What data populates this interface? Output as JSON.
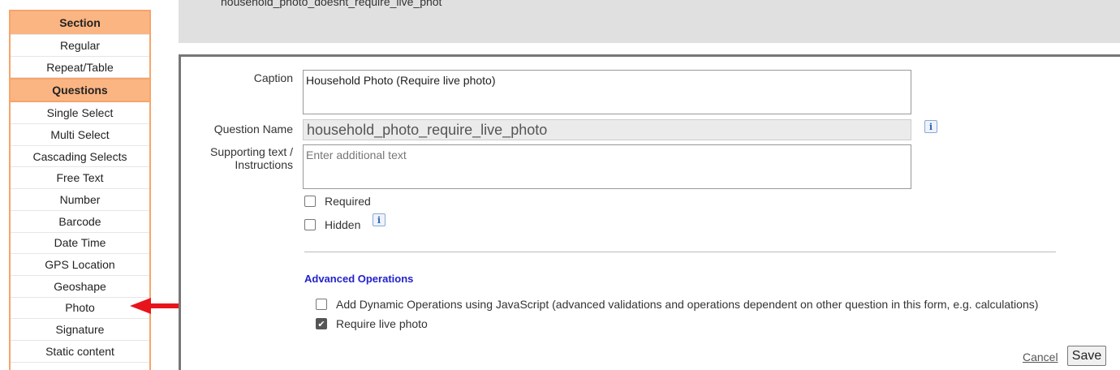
{
  "palette": {
    "section_header": "Section",
    "section_items": [
      "Regular",
      "Repeat/Table"
    ],
    "questions_header": "Questions",
    "question_items": [
      "Single Select",
      "Multi Select",
      "Cascading Selects",
      "Free Text",
      "Number",
      "Barcode",
      "Date Time",
      "GPS Location",
      "Geoshape",
      "Photo",
      "Signature",
      "Static content"
    ]
  },
  "previous_question": {
    "text": "household_photo_doesnt_require_live_phot"
  },
  "editor": {
    "caption_label": "Caption",
    "caption_value": "Household Photo (Require live photo)",
    "question_name_label": "Question Name",
    "question_name_value": "household_photo_require_live_photo",
    "supporting_label_line1": "Supporting text /",
    "supporting_label_line2": "Instructions",
    "supporting_placeholder": "Enter additional text",
    "required_label": "Required",
    "required_checked": false,
    "hidden_label": "Hidden",
    "hidden_checked": false,
    "advanced_title": "Advanced Operations",
    "dynamic_ops_label": "Add Dynamic Operations using JavaScript (advanced validations and operations dependent on other question in this form, e.g. calculations)",
    "dynamic_ops_checked": false,
    "live_photo_label": "Require live photo",
    "live_photo_checked": true,
    "cancel_label": "Cancel",
    "save_label": "Save"
  },
  "icons": {
    "info": "info-icon",
    "check": "✔",
    "annotation_arrow": "red-arrow-icon"
  },
  "colors": {
    "palette_border": "#f7a46a",
    "palette_header": "#fbb582",
    "advanced_title": "#2222cc",
    "annotation_arrow": "#e8141c"
  }
}
